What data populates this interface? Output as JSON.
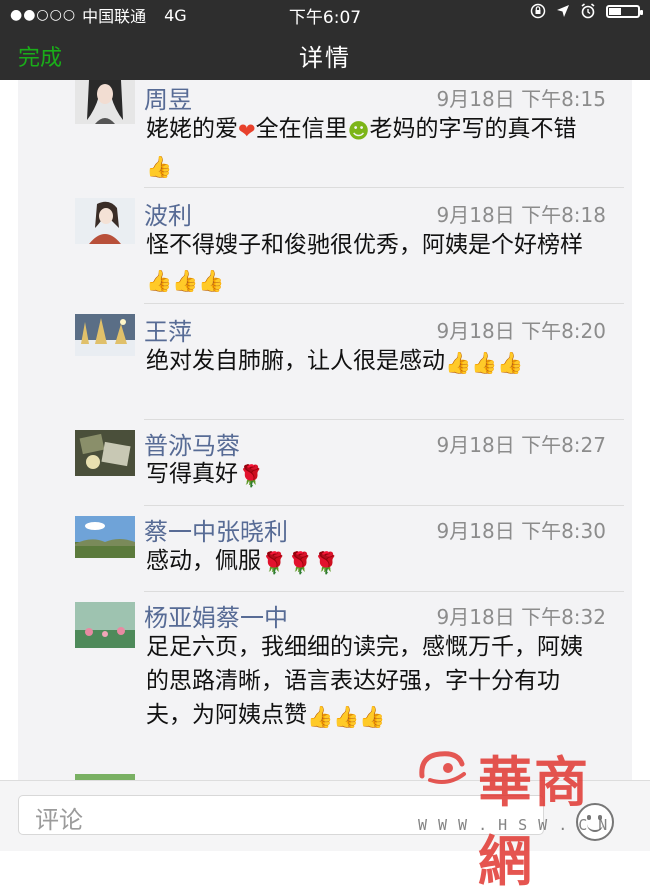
{
  "status_bar": {
    "carrier": "中国联通",
    "network": "4G",
    "time": "下午6:07"
  },
  "nav": {
    "done": "完成",
    "title": "详情"
  },
  "comments": [
    {
      "name": "周昱",
      "time": "9月18日 下午8:15",
      "text": [
        {
          "t": "姥姥的爱"
        },
        {
          "e": "heart"
        },
        {
          "t": "全在信里"
        },
        {
          "e": "smiley"
        },
        {
          "t": "老妈的字写的真不错"
        },
        {
          "e": "thumb"
        }
      ]
    },
    {
      "name": "波利",
      "time": "9月18日 下午8:18",
      "text": [
        {
          "t": "怪不得嫂子和俊驰很优秀，阿姨是个好榜样"
        },
        {
          "e": "thumb"
        },
        {
          "e": "thumb"
        },
        {
          "e": "thumb"
        }
      ]
    },
    {
      "name": "王萍",
      "time": "9月18日 下午8:20",
      "text": [
        {
          "t": "绝对发自肺腑，让人很是感动"
        },
        {
          "e": "thumb"
        },
        {
          "e": "thumb"
        },
        {
          "e": "thumb"
        }
      ]
    },
    {
      "name": "普洂马蓉",
      "time": "9月18日 下午8:27",
      "text": [
        {
          "t": "写得真好"
        },
        {
          "e": "rose"
        }
      ]
    },
    {
      "name": "蔡一中张晓利",
      "time": "9月18日 下午8:30",
      "text": [
        {
          "t": "感动，佩服"
        },
        {
          "e": "rose"
        },
        {
          "e": "rose"
        },
        {
          "e": "rose"
        }
      ]
    },
    {
      "name": "杨亚娟蔡一中",
      "time": "9月18日 下午8:32",
      "text": [
        {
          "t": "足足六页，我细细的读完，感慨万千，阿姨的思路清晰，语言表达好强，字十分有功夫，为阿姨点赞"
        },
        {
          "e": "thumb"
        },
        {
          "e": "thumb"
        },
        {
          "e": "thumb"
        }
      ]
    }
  ],
  "emoji_glyphs": {
    "heart": "❤",
    "smiley": "☻",
    "thumb": "👍",
    "rose": "🌹"
  },
  "input": {
    "placeholder": "评论"
  },
  "watermark": {
    "text": "華商網",
    "url": "WWW.HSW.CN"
  },
  "colors": {
    "accent_green": "#1aad19",
    "name_blue": "#576b95",
    "bar_dark": "#2e2e2e",
    "watermark_red": "#e0302a"
  }
}
